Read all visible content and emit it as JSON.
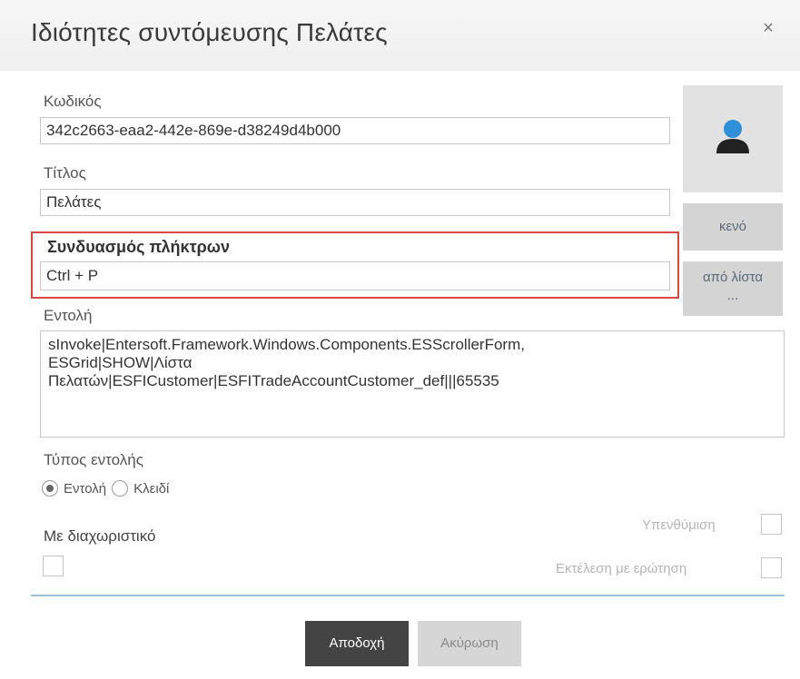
{
  "dialog": {
    "title": "Ιδιότητες συντόμευσης Πελάτες",
    "close_icon": "close-icon",
    "close_glyph": "×"
  },
  "fields": {
    "code_label": "Κωδικός",
    "code_value": "342c2663-eaa2-442e-869e-d38249d4b000",
    "title_label": "Τίτλος",
    "title_value": "Πελάτες",
    "hotkey_label": "Συνδυασμός πλήκτρων",
    "hotkey_value": "Ctrl + P",
    "command_label": "Εντολή",
    "command_value": "sInvoke|Entersoft.Framework.Windows.Components.ESScrollerForm,\nESGrid|SHOW|Λίστα\nΠελατών|ESFICustomer|ESFITradeAccountCustomer_def|||65535"
  },
  "side_buttons": {
    "empty_label": "κενό",
    "from_list_label": "από λίστα\n..."
  },
  "command_type": {
    "label": "Τύπος εντολής",
    "options": [
      "Εντολή",
      "Κλειδί"
    ],
    "selected": "Εντολή"
  },
  "separator": {
    "label": "Με διαχωριστικό",
    "checked": false
  },
  "options": {
    "reminder_label": "Υπενθύμιση",
    "reminder_checked": false,
    "confirm_label": "Εκτέλεση με ερώτηση",
    "confirm_checked": false
  },
  "footer": {
    "accept_label": "Αποδοχή",
    "cancel_label": "Ακύρωση"
  },
  "colors": {
    "highlight_border": "#d84545",
    "avatar_head": "#2f8fd8",
    "avatar_body": "#222222",
    "divider": "#9cc0e0"
  }
}
